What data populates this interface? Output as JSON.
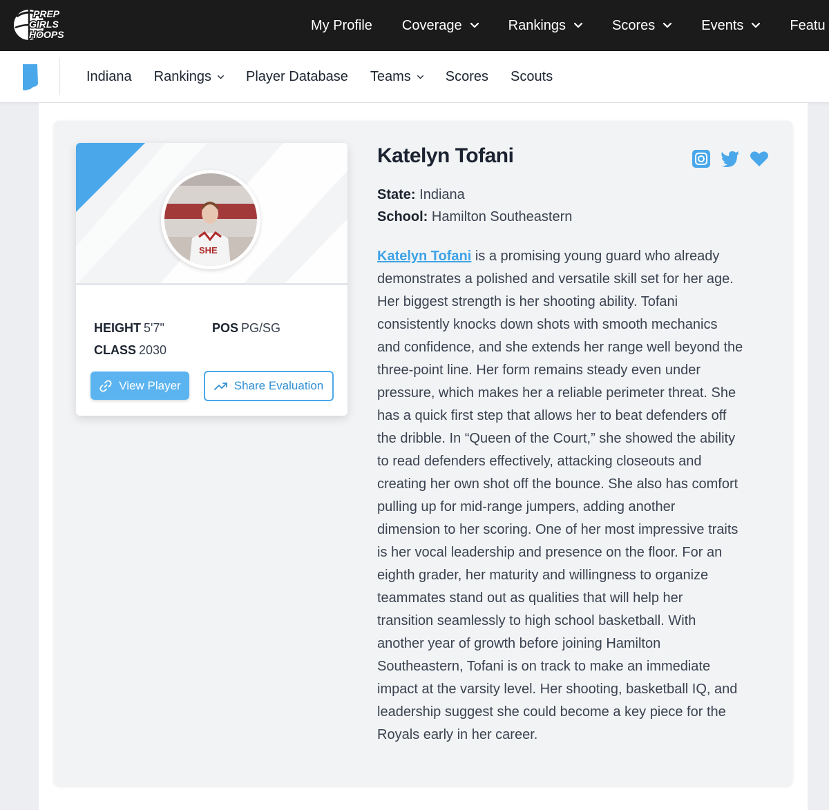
{
  "brand": {
    "logo_line1": "PREP",
    "logo_line2": "GIRLS",
    "logo_line3": "HOOPS"
  },
  "top_nav": [
    {
      "label": "My Profile",
      "dropdown": false
    },
    {
      "label": "Coverage",
      "dropdown": true
    },
    {
      "label": "Rankings",
      "dropdown": true
    },
    {
      "label": "Scores",
      "dropdown": true
    },
    {
      "label": "Events",
      "dropdown": true
    },
    {
      "label": "Featu",
      "dropdown": false
    }
  ],
  "sub_nav": [
    {
      "label": "Indiana",
      "dropdown": false
    },
    {
      "label": "Rankings",
      "dropdown": true
    },
    {
      "label": "Player Database",
      "dropdown": false
    },
    {
      "label": "Teams",
      "dropdown": true
    },
    {
      "label": "Scores",
      "dropdown": false
    },
    {
      "label": "Scouts",
      "dropdown": false
    }
  ],
  "player": {
    "name": "Katelyn Tofani",
    "height_label": "HEIGHT",
    "height": "5'7\"",
    "pos_label": "POS",
    "pos": "PG/SG",
    "class_label": "CLASS",
    "class": "2030",
    "state_label": "State:",
    "state": "Indiana",
    "school_label": "School:",
    "school": "Hamilton Southeastern",
    "jersey_text": "SHE"
  },
  "buttons": {
    "view_player": "View Player",
    "share_evaluation": "Share Evaluation"
  },
  "social": [
    "instagram-icon",
    "twitter-icon",
    "heart-icon"
  ],
  "bio": {
    "link_text": "Katelyn Tofani",
    "first_line_rest": " is a promising young guard who already",
    "lines": [
      "demonstrates a polished and versatile skill set for her age.",
      "Her biggest strength is her shooting ability. Tofani",
      "consistently knocks down shots with smooth mechanics",
      "and confidence, and she extends her range well beyond the",
      "three-point line. Her form remains steady even under",
      "pressure, which makes her a reliable perimeter threat. She",
      "has a quick first step that allows her to beat defenders off",
      "the dribble. In “Queen of the Court,” she showed the ability",
      "to read defenders effectively, attacking closeouts and",
      "creating her own shot off the bounce. She also has comfort",
      "pulling up for mid-range jumpers, adding another",
      "dimension to her scoring. One of her most impressive traits",
      "is her vocal leadership and presence on the floor. For an",
      "eighth grader, her maturity and willingness to organize",
      "teammates stand out as qualities that will help her",
      "transition seamlessly to high school basketball. With",
      "another year of growth before joining Hamilton",
      "Southeastern, Tofani is on track to make an immediate",
      "impact at the varsity level. Her shooting, basketball IQ, and",
      "leadership suggest she could become a key piece for the",
      "Royals early in her career."
    ]
  },
  "colors": {
    "accent": "#5bb4f0",
    "link": "#3ea3e6",
    "topbar": "#1b1b1b"
  }
}
